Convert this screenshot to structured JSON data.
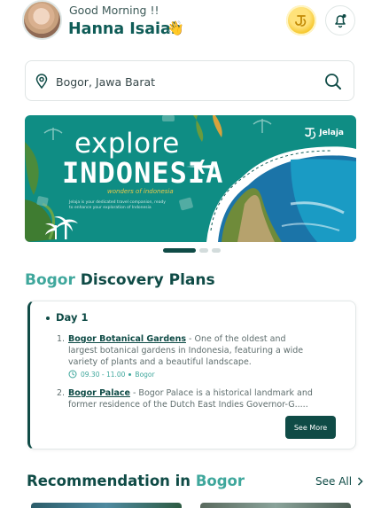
{
  "header": {
    "greeting": "Good Morning !!",
    "user_name": "Hanna Isaiah",
    "wave_emoji": "👋",
    "coin_icon": "jelaja-coin-icon",
    "bell_icon": "bell-icon"
  },
  "search": {
    "value": "Bogor, Jawa Barat",
    "placeholder": "Bogor, Jawa Barat"
  },
  "banner": {
    "line1": "explore",
    "line2": "INDONESIA",
    "tagline": "wonders of indonesia",
    "small_text": "Jelaja is your dedicated travel companion, ready to enhance your exploration of Indonesia",
    "brand": "Jelaja",
    "active_slide": 1,
    "slide_count": 3
  },
  "discovery": {
    "city": "Bogor",
    "title_rest": "Discovery Plans",
    "day_label": "Day 1",
    "items": [
      {
        "num": "1.",
        "place": "Bogor Botanical Gardens",
        "desc": " - One of the oldest and largest botanical gardens in Indonesia, featuring a wide variety of plants and a beautiful landscape.",
        "time": "09.30 - 11.00",
        "location": "Bogor"
      },
      {
        "num": "2.",
        "place": "Bogor Palace",
        "desc": " - Bogor Palace is a historical landmark and former residence of the Dutch East Indies Governor-G....."
      }
    ],
    "more_button": "See More"
  },
  "recommendation": {
    "title": "Recommendation in",
    "city": "Bogor",
    "see_all": "See All"
  },
  "colors": {
    "primary": "#0f4b46",
    "accent": "#3fa79c",
    "banner": "#0f8d84",
    "coin": "#f4c21f"
  }
}
